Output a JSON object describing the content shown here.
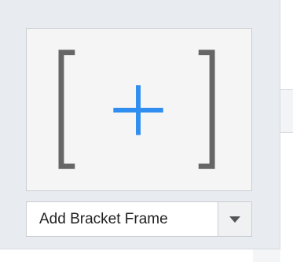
{
  "control": {
    "label": "Add Bracket Frame",
    "preview_icon": "bracket-frame-add-icon",
    "dropdown_icon": "chevron-down-icon"
  },
  "colors": {
    "panel_bg": "#e8ebef",
    "bracket": "#666666",
    "plus": "#2f8ef0"
  }
}
